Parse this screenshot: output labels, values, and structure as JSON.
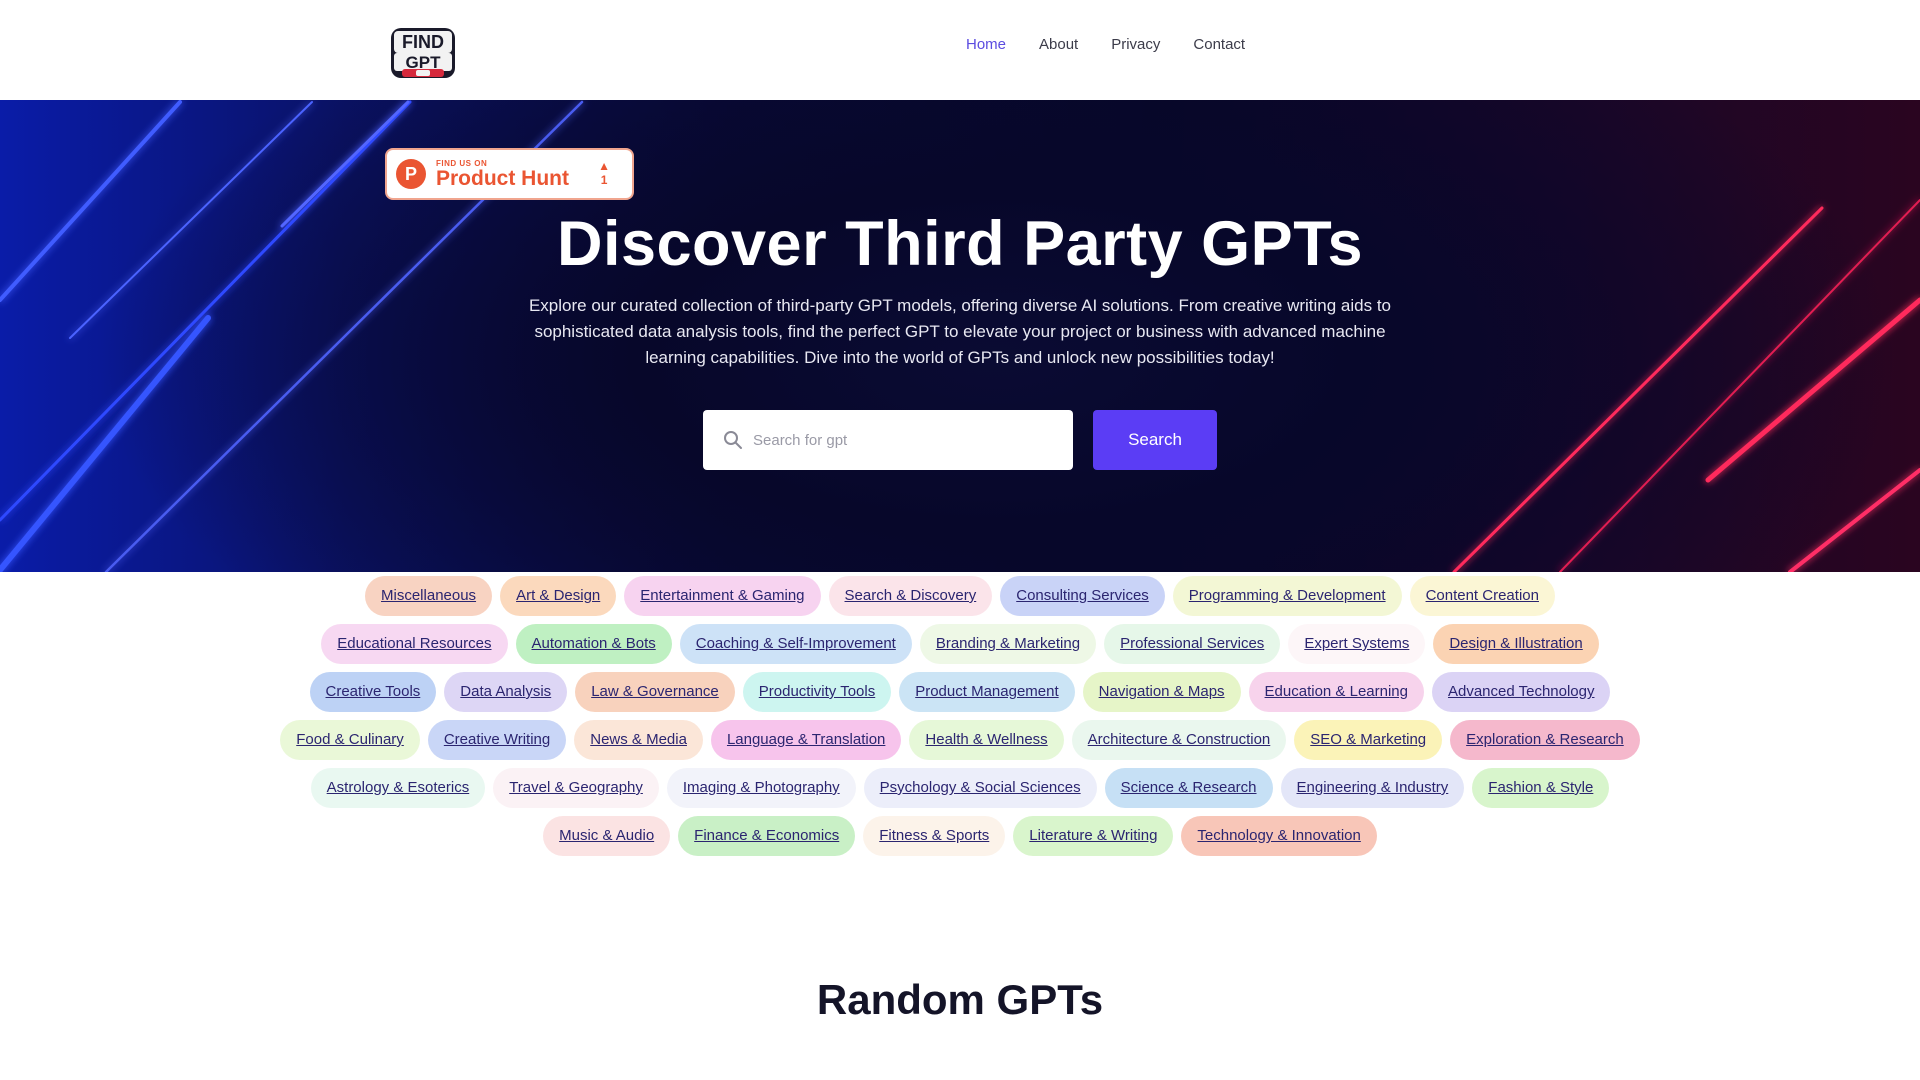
{
  "header": {
    "logo_text": "FIND GPT PRO",
    "nav": [
      {
        "label": "Home",
        "active": true
      },
      {
        "label": "About",
        "active": false
      },
      {
        "label": "Privacy",
        "active": false
      },
      {
        "label": "Contact",
        "active": false
      }
    ]
  },
  "hero": {
    "product_hunt": {
      "small": "FIND US ON",
      "big": "Product Hunt",
      "votes": "1",
      "letter": "P"
    },
    "title": "Discover Third Party GPTs",
    "description": "Explore our curated collection of third-party GPT models, offering diverse AI solutions. From creative writing aids to sophisticated data analysis tools, find the perfect GPT to elevate your project or business with advanced machine learning capabilities. Dive into the world of GPTs and unlock new possibilities today!",
    "search": {
      "placeholder": "Search for gpt",
      "value": "",
      "button_label": "Search"
    }
  },
  "categories": [
    {
      "label": "Miscellaneous",
      "color": "#f8d3c2"
    },
    {
      "label": "Art & Design",
      "color": "#fbd9bd"
    },
    {
      "label": "Entertainment & Gaming",
      "color": "#f7d3f0"
    },
    {
      "label": "Search & Discovery",
      "color": "#fbe4ea"
    },
    {
      "label": "Consulting Services",
      "color": "#c9d3f7"
    },
    {
      "label": "Programming & Development",
      "color": "#f3f7d5"
    },
    {
      "label": "Content Creation",
      "color": "#fbf6d5"
    },
    {
      "label": "Educational Resources",
      "color": "#f7d8f2"
    },
    {
      "label": "Automation & Bots",
      "color": "#bff0c2"
    },
    {
      "label": "Coaching & Self-Improvement",
      "color": "#cde2f7"
    },
    {
      "label": "Branding & Marketing",
      "color": "#eef8e6"
    },
    {
      "label": "Professional Services",
      "color": "#e6f7e9"
    },
    {
      "label": "Expert Systems",
      "color": "#fdf6f8"
    },
    {
      "label": "Design & Illustration",
      "color": "#fbd3b3"
    },
    {
      "label": "Creative Tools",
      "color": "#bdd2f5"
    },
    {
      "label": "Data Analysis",
      "color": "#ddd6f5"
    },
    {
      "label": "Law & Governance",
      "color": "#f8d2bd"
    },
    {
      "label": "Productivity Tools",
      "color": "#cdf5f0"
    },
    {
      "label": "Product Management",
      "color": "#cbe4f5"
    },
    {
      "label": "Navigation & Maps",
      "color": "#e6f5c8"
    },
    {
      "label": "Education & Learning",
      "color": "#f7d3ec"
    },
    {
      "label": "Advanced Technology",
      "color": "#dbd3f5"
    },
    {
      "label": "Food & Culinary",
      "color": "#eaf8d8"
    },
    {
      "label": "Creative Writing",
      "color": "#c9d6f7"
    },
    {
      "label": "News & Media",
      "color": "#fbe6d8"
    },
    {
      "label": "Language & Translation",
      "color": "#f7c4ec"
    },
    {
      "label": "Health & Wellness",
      "color": "#e6f8d8"
    },
    {
      "label": "Architecture & Construction",
      "color": "#eaf7ee"
    },
    {
      "label": "SEO & Marketing",
      "color": "#fbf3b8"
    },
    {
      "label": "Exploration & Research",
      "color": "#f5b8cc"
    },
    {
      "label": "Astrology & Esoterics",
      "color": "#e9f8f1"
    },
    {
      "label": "Travel & Geography",
      "color": "#fbf2f5"
    },
    {
      "label": "Imaging & Photography",
      "color": "#f2f3fa"
    },
    {
      "label": "Psychology & Social Sciences",
      "color": "#eceefa"
    },
    {
      "label": "Science & Research",
      "color": "#c6e0f5"
    },
    {
      "label": "Engineering & Industry",
      "color": "#e3e6f8"
    },
    {
      "label": "Fashion & Style",
      "color": "#d8f5cc"
    },
    {
      "label": "Music & Audio",
      "color": "#fbe3e3"
    },
    {
      "label": "Finance & Economics",
      "color": "#c9f0c6"
    },
    {
      "label": "Fitness & Sports",
      "color": "#fcf3ea"
    },
    {
      "label": "Literature & Writing",
      "color": "#d9f5cc"
    },
    {
      "label": "Technology & Innovation",
      "color": "#f8c6b8"
    }
  ],
  "random_section": {
    "title": "Random GPTs"
  }
}
